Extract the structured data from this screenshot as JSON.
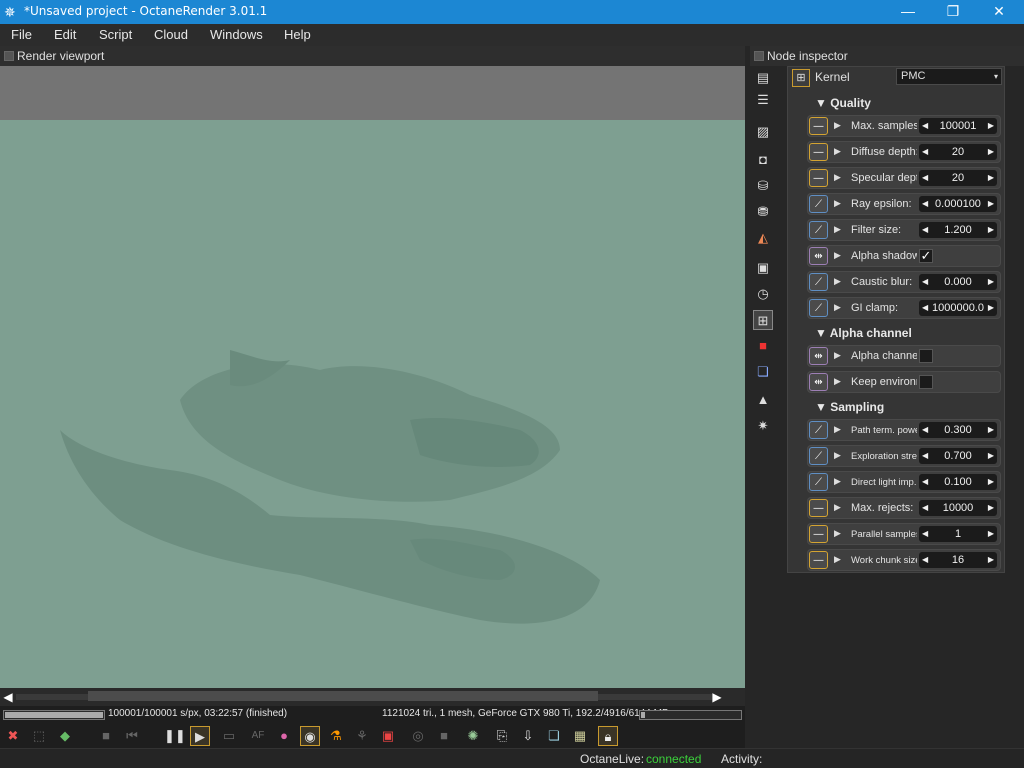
{
  "window": {
    "title": "*Unsaved project - OctaneRender 3.01.1",
    "minimize": "—",
    "maximize": "❐",
    "close": "✕"
  },
  "menu": [
    "File",
    "Edit",
    "Script",
    "Cloud",
    "Windows",
    "Help"
  ],
  "viewport": {
    "title": "Render viewport",
    "progress_text": "100001/100001 s/px, 03:22:57 (finished)",
    "progress_fraction": 1.0,
    "scene_info": "1121024 tri., 1 mesh, GeForce GTX 980 Ti, 192.2/4916/6144 MB",
    "memory_fraction": 0.04
  },
  "inspector": {
    "title": "Node inspector",
    "kernel_label": "Kernel",
    "kernel_value": "PMC",
    "sections": {
      "quality": "▼ Quality",
      "alpha": "▼ Alpha channel",
      "sampling": "▼ Sampling"
    },
    "params": [
      {
        "label": "Max. samples:",
        "value": "100001",
        "icon": "yellow"
      },
      {
        "label": "Diffuse depth:",
        "value": "20",
        "icon": "yellow"
      },
      {
        "label": "Specular depth:",
        "value": "20",
        "icon": "yellow"
      },
      {
        "label": "Ray epsilon:",
        "value": "0.000100",
        "icon": "blue"
      },
      {
        "label": "Filter size:",
        "value": "1.200",
        "icon": "blue"
      },
      {
        "label": "Alpha shadows:",
        "checked": true,
        "icon": "purple"
      },
      {
        "label": "Caustic blur:",
        "value": "0.000",
        "icon": "blue"
      },
      {
        "label": "GI clamp:",
        "value": "1000000.0",
        "icon": "blue"
      },
      {
        "label": "Alpha channel:",
        "checked": false,
        "icon": "purple"
      },
      {
        "label": "Keep environment:",
        "checked": false,
        "icon": "purple"
      },
      {
        "label": "Path term. power:",
        "value": "0.300",
        "icon": "blue"
      },
      {
        "label": "Exploration stre...",
        "value": "0.700",
        "icon": "blue"
      },
      {
        "label": "Direct light imp...",
        "value": "0.100",
        "icon": "blue"
      },
      {
        "label": "Max. rejects:",
        "value": "10000",
        "icon": "yellow"
      },
      {
        "label": "Parallel samples:",
        "value": "1",
        "icon": "yellow"
      },
      {
        "label": "Work chunk size:",
        "value": "16",
        "icon": "yellow"
      }
    ],
    "checkmark": "✓"
  },
  "status": {
    "live_label": "OctaneLive:",
    "live_value": "connected",
    "activity_label": "Activity:",
    "ok_color": "#3bd13b"
  },
  "icons": {
    "arrow_left": "◀",
    "arrow_right": "▶",
    "spin_left": "◀",
    "spin_right": "▶",
    "expand": "▶",
    "dropdown": "▾"
  }
}
